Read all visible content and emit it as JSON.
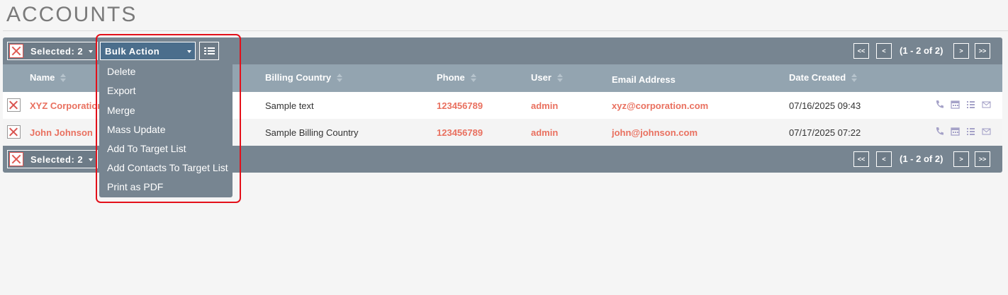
{
  "page": {
    "title": "ACCOUNTS"
  },
  "toolbar": {
    "selected_label": "Selected: 2",
    "bulk_action_label": "Bulk Action",
    "pagination_info": "(1 - 2 of 2)",
    "first_label": "<<",
    "prev_label": "<",
    "next_label": ">",
    "last_label": ">>"
  },
  "columns": [
    "Name",
    "Billing Country",
    "Phone",
    "User",
    "Email Address",
    "Date Created"
  ],
  "rows": [
    {
      "name": "XYZ Corporation",
      "billing_country": "Sample text",
      "phone": "123456789",
      "user": "admin",
      "email": "xyz@corporation.com",
      "date_created": "07/16/2025 09:43"
    },
    {
      "name": "John Johnson",
      "billing_country": "Sample Billing Country",
      "phone": "123456789",
      "user": "admin",
      "email": "john@johnson.com",
      "date_created": "07/17/2025 07:22"
    }
  ],
  "bulk_menu": {
    "items": [
      "Delete",
      "Export",
      "Merge",
      "Mass Update",
      "Add To Target List",
      "Add Contacts To Target List",
      "Print as PDF"
    ]
  },
  "colors": {
    "toolbar_bg": "#778591",
    "header_bg": "#93a4b0",
    "bulk_button_bg": "#4b6e8c",
    "link": "#e9705f",
    "highlight": "#e3101a",
    "icon": "#a5a2c8"
  },
  "icons": [
    "phone-icon",
    "calendar-icon",
    "list-icon",
    "email-icon"
  ]
}
